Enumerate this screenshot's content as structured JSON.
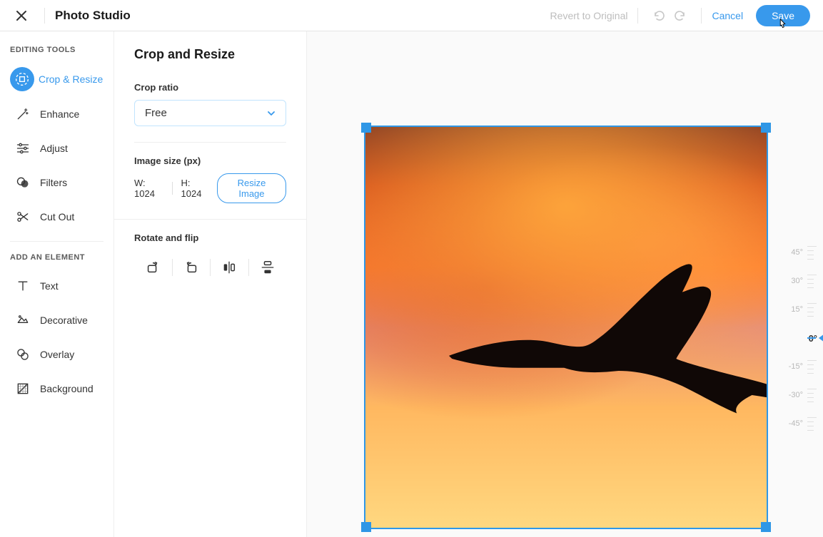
{
  "header": {
    "title": "Photo Studio",
    "revert_label": "Revert to Original",
    "cancel_label": "Cancel",
    "save_label": "Save"
  },
  "sidebar": {
    "section1_title": "EDITING TOOLS",
    "section2_title": "ADD AN ELEMENT",
    "editing_tools": [
      {
        "label": "Crop & Resize",
        "icon": "crop-icon",
        "active": true
      },
      {
        "label": "Enhance",
        "icon": "wand-icon",
        "active": false
      },
      {
        "label": "Adjust",
        "icon": "sliders-icon",
        "active": false
      },
      {
        "label": "Filters",
        "icon": "filters-icon",
        "active": false
      },
      {
        "label": "Cut Out",
        "icon": "scissors-icon",
        "active": false
      }
    ],
    "add_elements": [
      {
        "label": "Text",
        "icon": "text-icon"
      },
      {
        "label": "Decorative",
        "icon": "decorative-icon"
      },
      {
        "label": "Overlay",
        "icon": "overlay-icon"
      },
      {
        "label": "Background",
        "icon": "background-icon"
      }
    ]
  },
  "panel": {
    "title": "Crop and Resize",
    "crop_ratio_label": "Crop ratio",
    "crop_ratio_value": "Free",
    "image_size_label": "Image size (px)",
    "width_label": "W:",
    "width_value": "1024",
    "height_label": "H:",
    "height_value": "1024",
    "resize_button": "Resize Image",
    "rotate_flip_label": "Rotate and flip"
  },
  "angle_scale": {
    "ticks": [
      "45°",
      "30°",
      "15°",
      "0°",
      "-15°",
      "-30°",
      "-45°"
    ],
    "active_index": 3
  },
  "colors": {
    "accent": "#3899ec"
  }
}
